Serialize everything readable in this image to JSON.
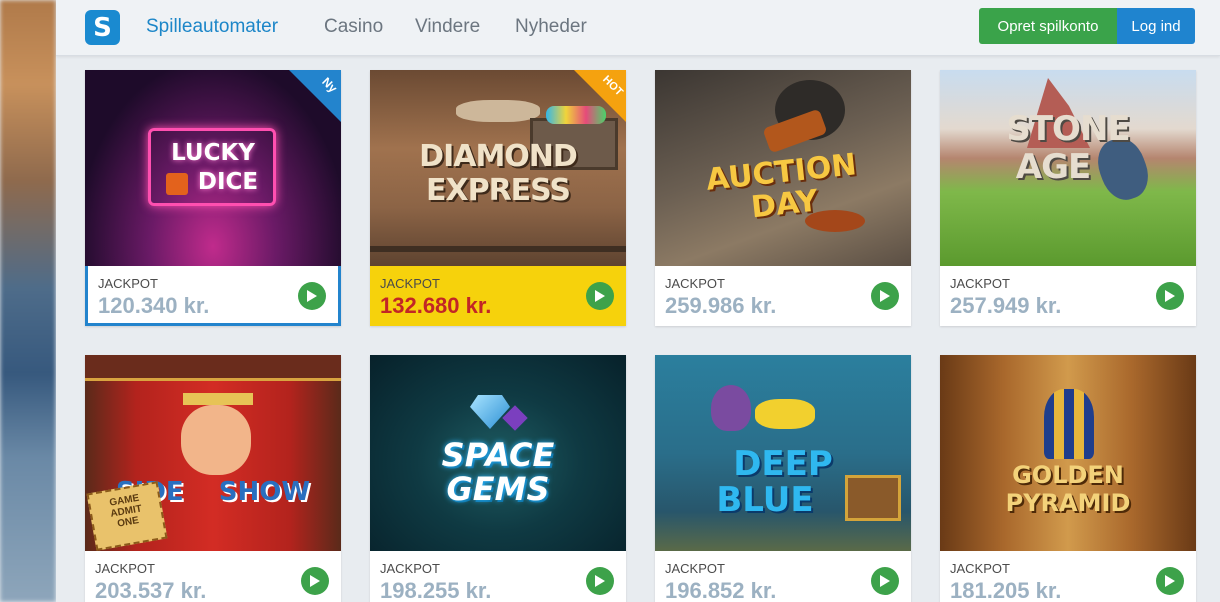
{
  "header": {
    "logo_letter": "S",
    "nav": [
      "Spilleautomater",
      "Casino",
      "Vindere",
      "Nyheder"
    ],
    "signup_label": "Opret spilkonto",
    "login_label": "Log ind"
  },
  "games": [
    {
      "title_lines": [
        "LUCKY",
        "DICE"
      ],
      "badge": "Ny",
      "jackpot_label": "JACKPOT",
      "jackpot_value": "120.340 kr."
    },
    {
      "title_lines": [
        "DIAMOND",
        "EXPRESS"
      ],
      "badge": "HOT",
      "jackpot_label": "JACKPOT",
      "jackpot_value": "132.680 kr."
    },
    {
      "title_lines": [
        "AUCTION",
        "DAY"
      ],
      "jackpot_label": "JACKPOT",
      "jackpot_value": "259.986 kr."
    },
    {
      "title_lines": [
        "STONE",
        "AGE"
      ],
      "jackpot_label": "JACKPOT",
      "jackpot_value": "257.949 kr."
    },
    {
      "title_lines": [
        "SIDE",
        "SHOW"
      ],
      "ticket_lines": [
        "GAME",
        "ADMIT",
        "ONE"
      ],
      "jackpot_label": "JACKPOT",
      "jackpot_value": "203.537 kr."
    },
    {
      "title_lines": [
        "SPACE",
        "GEMS"
      ],
      "jackpot_label": "JACKPOT",
      "jackpot_value": "198.255 kr."
    },
    {
      "title_lines": [
        "DEEP",
        "BLUE"
      ],
      "jackpot_label": "JACKPOT",
      "jackpot_value": "196.852 kr."
    },
    {
      "title_lines": [
        "GOLDEN",
        "PYRAMID"
      ],
      "jackpot_label": "JACKPOT",
      "jackpot_value": "181.205 kr."
    }
  ],
  "colors": {
    "brand_blue": "#1f84cf",
    "signup_green": "#3aa34a",
    "hot_yellow": "#f6d20c",
    "jackpot_value": "#9cb1c2",
    "jackpot_hot_value": "#c22626"
  },
  "icons": {
    "play": "play-icon",
    "logo": "logo-icon"
  }
}
